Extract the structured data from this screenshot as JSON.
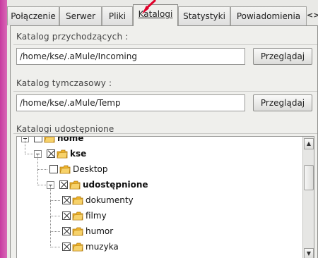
{
  "tabs": [
    {
      "label": "Połączenie",
      "active": false
    },
    {
      "label": "Serwer",
      "active": false
    },
    {
      "label": "Pliki",
      "active": false
    },
    {
      "label": "Katalogi",
      "active": true
    },
    {
      "label": "Statystyki",
      "active": false
    },
    {
      "label": "Powiadomienia",
      "active": false
    }
  ],
  "tab_scroll_label": "<>",
  "incoming": {
    "label": "Katalog przychodzących :",
    "path": "/home/kse/.aMule/Incoming",
    "button": "Przeglądaj"
  },
  "temp": {
    "label": "Katalog tymczasowy :",
    "path": "/home/kse/.aMule/Temp",
    "button": "Przeglądaj"
  },
  "shared": {
    "label": "Katalogi udostępnione",
    "tree": [
      {
        "name": "home",
        "depth": 0,
        "checked": false,
        "bold": true,
        "expander": true
      },
      {
        "name": "kse",
        "depth": 1,
        "checked": true,
        "bold": true,
        "expander": true
      },
      {
        "name": "Desktop",
        "depth": 2,
        "checked": false,
        "bold": false,
        "expander": false
      },
      {
        "name": "udostępnione",
        "depth": 2,
        "checked": true,
        "bold": true,
        "expander": true
      },
      {
        "name": "dokumenty",
        "depth": 3,
        "checked": true,
        "bold": false,
        "expander": false
      },
      {
        "name": "filmy",
        "depth": 3,
        "checked": true,
        "bold": false,
        "expander": false
      },
      {
        "name": "humor",
        "depth": 3,
        "checked": true,
        "bold": false,
        "expander": false
      },
      {
        "name": "muzyka",
        "depth": 3,
        "checked": true,
        "bold": false,
        "expander": false
      }
    ]
  },
  "colors": {
    "accent_cursor": "#e0002a",
    "folder": "#f0b429"
  }
}
